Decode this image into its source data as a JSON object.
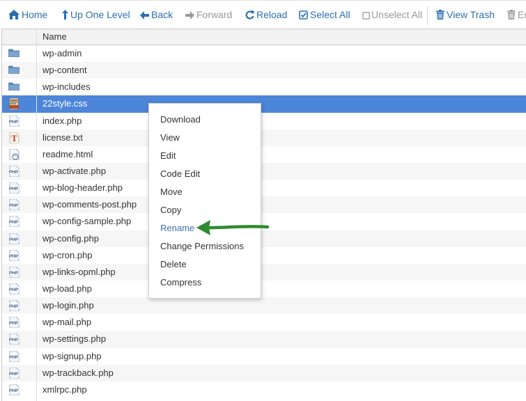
{
  "toolbar": {
    "home": "Home",
    "up": "Up One Level",
    "back": "Back",
    "forward": "Forward",
    "reload": "Reload",
    "select_all": "Select All",
    "unselect_all": "Unselect All",
    "view_trash": "View Trash",
    "empty_trash_partial": "Er"
  },
  "table": {
    "header_name": "Name",
    "rows": [
      {
        "name": "wp-admin",
        "icon": "folder"
      },
      {
        "name": "wp-content",
        "icon": "folder"
      },
      {
        "name": "wp-includes",
        "icon": "folder"
      },
      {
        "name": "22style.css",
        "icon": "css",
        "selected": true
      },
      {
        "name": "index.php",
        "icon": "php"
      },
      {
        "name": "license.txt",
        "icon": "text"
      },
      {
        "name": "readme.html",
        "icon": "html"
      },
      {
        "name": "wp-activate.php",
        "icon": "php"
      },
      {
        "name": "wp-blog-header.php",
        "icon": "php"
      },
      {
        "name": "wp-comments-post.php",
        "icon": "php"
      },
      {
        "name": "wp-config-sample.php",
        "icon": "php"
      },
      {
        "name": "wp-config.php",
        "icon": "php"
      },
      {
        "name": "wp-cron.php",
        "icon": "php"
      },
      {
        "name": "wp-links-opml.php",
        "icon": "php"
      },
      {
        "name": "wp-load.php",
        "icon": "php"
      },
      {
        "name": "wp-login.php",
        "icon": "php"
      },
      {
        "name": "wp-mail.php",
        "icon": "php"
      },
      {
        "name": "wp-settings.php",
        "icon": "php"
      },
      {
        "name": "wp-signup.php",
        "icon": "php"
      },
      {
        "name": "wp-trackback.php",
        "icon": "php"
      },
      {
        "name": "xmlrpc.php",
        "icon": "php"
      }
    ]
  },
  "context_menu": {
    "items": [
      "Download",
      "View",
      "Edit",
      "Code Edit",
      "Move",
      "Copy",
      "Rename",
      "Change Permissions",
      "Delete",
      "Compress"
    ],
    "highlighted": "Rename"
  },
  "colors": {
    "toolbar_link": "#2a6fb0",
    "toolbar_disabled": "#999999",
    "selected_row": "#4d86d9",
    "arrow": "#2e8b2e"
  }
}
